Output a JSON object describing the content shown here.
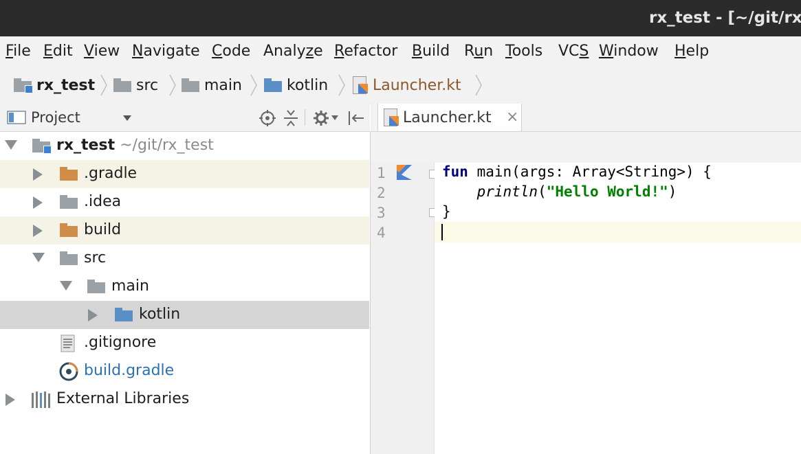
{
  "window": {
    "title": "rx_test - [~/git/rx"
  },
  "menu": [
    {
      "pre": "",
      "mn": "F",
      "post": "ile"
    },
    {
      "pre": "",
      "mn": "E",
      "post": "dit"
    },
    {
      "pre": "",
      "mn": "V",
      "post": "iew"
    },
    {
      "pre": "",
      "mn": "N",
      "post": "avigate"
    },
    {
      "pre": "",
      "mn": "C",
      "post": "ode"
    },
    {
      "pre": "Analy",
      "mn": "z",
      "post": "e"
    },
    {
      "pre": "",
      "mn": "R",
      "post": "efactor"
    },
    {
      "pre": "",
      "mn": "B",
      "post": "uild"
    },
    {
      "pre": "R",
      "mn": "u",
      "post": "n"
    },
    {
      "pre": "",
      "mn": "T",
      "post": "ools"
    },
    {
      "pre": "VC",
      "mn": "S",
      "post": ""
    },
    {
      "pre": "",
      "mn": "W",
      "post": "indow"
    },
    {
      "pre": "",
      "mn": "H",
      "post": "elp"
    }
  ],
  "breadcrumb": [
    {
      "label": "rx_test",
      "icon": "module-folder-icon"
    },
    {
      "label": "src",
      "icon": "folder-icon"
    },
    {
      "label": "main",
      "icon": "folder-icon"
    },
    {
      "label": "kotlin",
      "icon": "source-folder-icon"
    },
    {
      "label": "Launcher.kt",
      "icon": "kotlin-file-icon"
    }
  ],
  "project_panel": {
    "title": "Project",
    "root": {
      "label": "rx_test",
      "path": "~/git/rx_test"
    },
    "nodes": [
      {
        "label": ".gradle"
      },
      {
        "label": ".idea"
      },
      {
        "label": "build"
      },
      {
        "label": "src"
      },
      {
        "label": "main"
      },
      {
        "label": "kotlin"
      },
      {
        "label": ".gitignore"
      },
      {
        "label": "build.gradle"
      },
      {
        "label": "External Libraries"
      }
    ]
  },
  "editor": {
    "tab_label": "Launcher.kt",
    "close_glyph": "×",
    "line_numbers": [
      "1",
      "2",
      "3",
      "4"
    ],
    "code": {
      "l1_kw": "fun",
      "l1_rest": " main(args: Array<String>) {",
      "l2_indent": "    ",
      "l2_fn": "println",
      "l2_open": "(",
      "l2_str": "\"Hello World!\"",
      "l2_close": ")",
      "l3": "}"
    }
  },
  "colors": {
    "titlebar": "#2b2b2b",
    "chrome": "#f2f2f2",
    "selected_row": "#d5d5d5",
    "excluded_row": "#f5f3e6",
    "link_blue": "#2a72b5"
  }
}
